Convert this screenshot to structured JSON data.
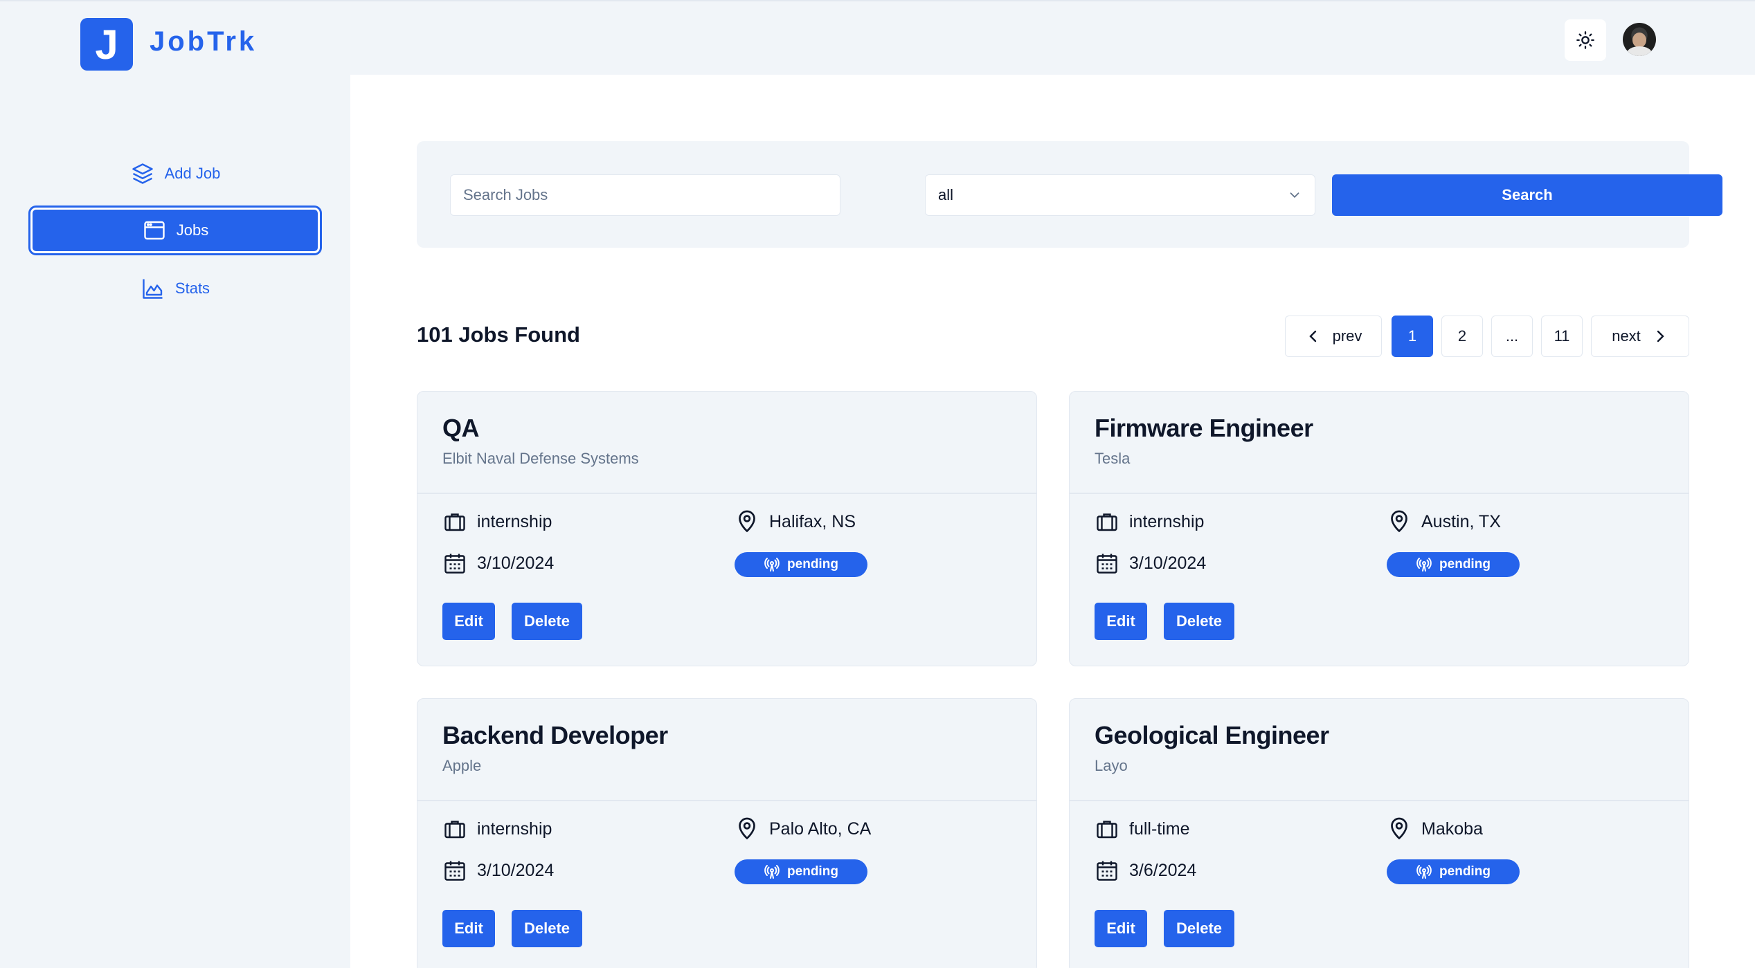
{
  "brand": {
    "logo_letter": "J",
    "name": "JobTrk"
  },
  "header": {
    "theme_icon": "sun-icon",
    "avatar_alt": "user avatar"
  },
  "sidebar": {
    "items": [
      {
        "label": "Add Job",
        "icon": "layers-icon",
        "active": false
      },
      {
        "label": "Jobs",
        "icon": "browser-window-icon",
        "active": true
      },
      {
        "label": "Stats",
        "icon": "area-chart-icon",
        "active": false
      }
    ]
  },
  "search": {
    "placeholder": "Search Jobs",
    "status_value": "all",
    "button_label": "Search"
  },
  "results": {
    "count_label": "101 Jobs Found"
  },
  "pagination": {
    "prev": "prev",
    "next": "next",
    "pages": [
      "1",
      "2",
      "...",
      "11"
    ],
    "current": "1"
  },
  "colors": {
    "accent": "#2563eb",
    "bg": "#f1f5f9",
    "card_bg": "#f1f5f9",
    "muted": "#64748b"
  },
  "jobs": [
    {
      "title": "QA",
      "company": "Elbit Naval Defense Systems",
      "type": "internship",
      "location": "Halifax, NS",
      "date": "3/10/2024",
      "status": "pending",
      "edit_label": "Edit",
      "delete_label": "Delete"
    },
    {
      "title": "Firmware Engineer",
      "company": "Tesla",
      "type": "internship",
      "location": "Austin, TX",
      "date": "3/10/2024",
      "status": "pending",
      "edit_label": "Edit",
      "delete_label": "Delete"
    },
    {
      "title": "Backend Developer",
      "company": "Apple",
      "type": "internship",
      "location": "Palo Alto, CA",
      "date": "3/10/2024",
      "status": "pending",
      "edit_label": "Edit",
      "delete_label": "Delete"
    },
    {
      "title": "Geological Engineer",
      "company": "Layo",
      "type": "full-time",
      "location": "Makoba",
      "date": "3/6/2024",
      "status": "pending",
      "edit_label": "Edit",
      "delete_label": "Delete"
    }
  ]
}
